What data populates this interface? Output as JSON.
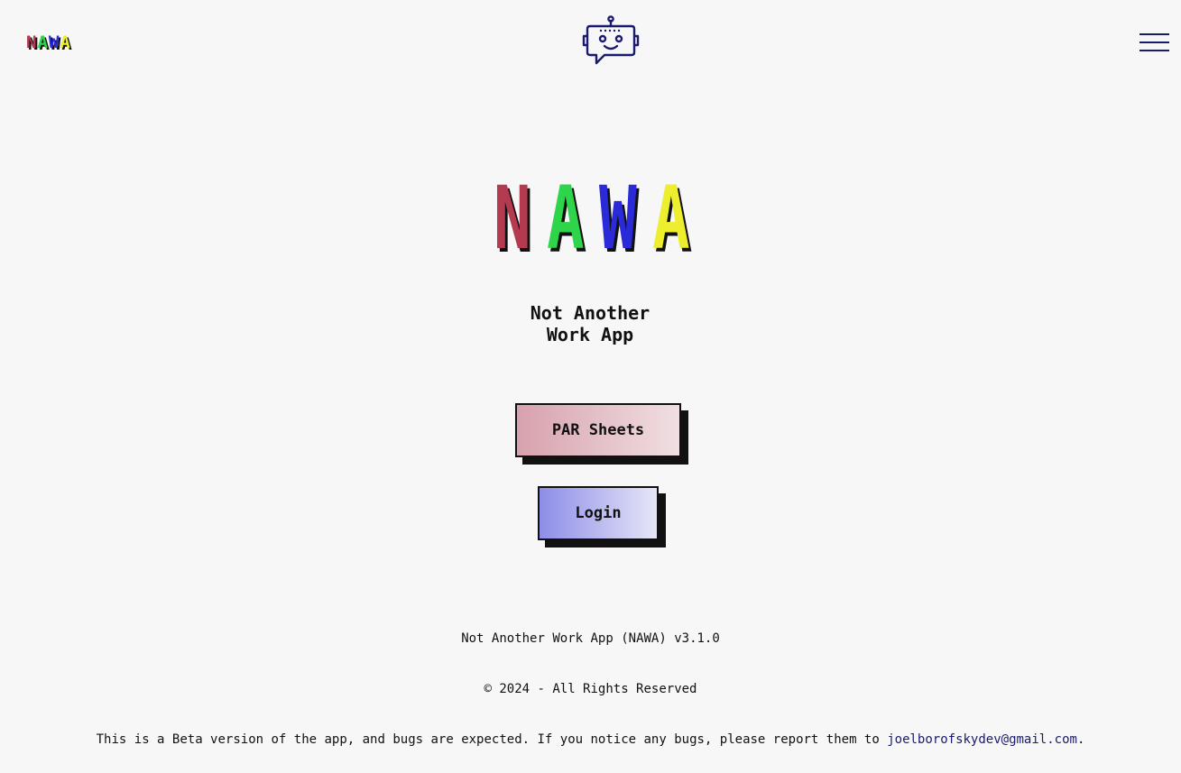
{
  "header": {
    "small_logo_letters": [
      {
        "char": "N",
        "color": "#b33a4f"
      },
      {
        "char": "A",
        "color": "#2ed44a"
      },
      {
        "char": "W",
        "color": "#2a2ad9"
      },
      {
        "char": "A",
        "color": "#ecee2e"
      }
    ],
    "icons": {
      "bot": "robot-chat-icon",
      "menu": "hamburger-menu-icon"
    }
  },
  "hero": {
    "logo_letters": [
      {
        "char": "N",
        "color": "#b33a4f"
      },
      {
        "char": "A",
        "color": "#2ed44a"
      },
      {
        "char": "W",
        "color": "#2a2ad9"
      },
      {
        "char": "A",
        "color": "#ecee2e"
      }
    ],
    "tagline_line1": "Not Another",
    "tagline_line2": "Work App"
  },
  "buttons": {
    "par_sheets": "PAR Sheets",
    "login": "Login"
  },
  "footer": {
    "version": "Not Another Work App (NAWA) v3.1.0",
    "copyright": "© 2024 - All Rights Reserved",
    "beta_notice": "This is a Beta version of the app, and bugs are expected. If you notice any bugs, please report them to ",
    "email": "joelborofskydev@gmail.com",
    "beta_end": "."
  },
  "colors": {
    "background": "#f7f7f7",
    "accent_navy": "#1a1a6e",
    "n": "#b33a4f",
    "a1": "#2ed44a",
    "w": "#2a2ad9",
    "a2": "#ecee2e"
  }
}
